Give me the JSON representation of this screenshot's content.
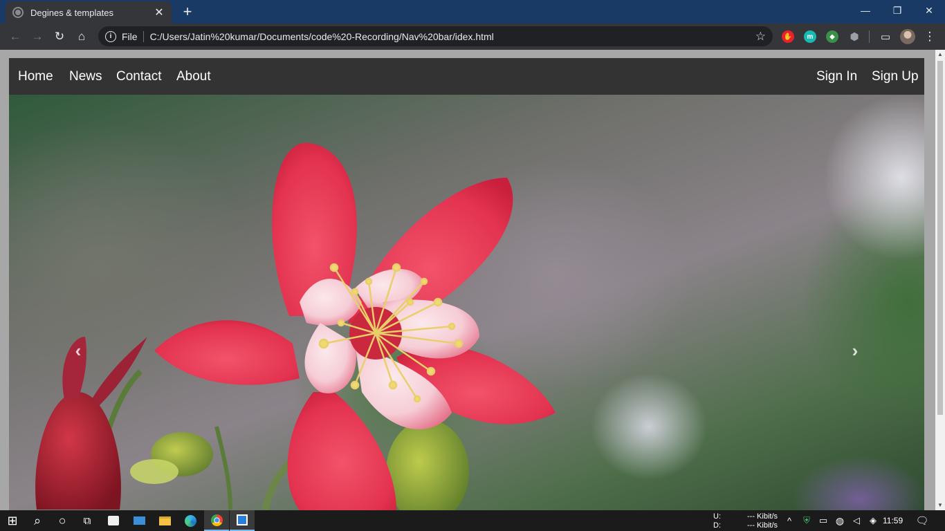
{
  "browser": {
    "tab_title": "Degines & templates",
    "tab_close": "✕",
    "new_tab": "+",
    "window_controls": {
      "minimize": "—",
      "restore": "❐",
      "close": "✕"
    },
    "toolbar": {
      "back": "←",
      "forward": "→",
      "reload": "↻",
      "home": "⌂"
    },
    "address": {
      "info_icon": "i",
      "scheme_label": "File",
      "url": "C:/Users/Jatin%20kumar/Documents/code%20-Recording/Nav%20bar/idex.html",
      "bookmark": "☆"
    },
    "extensions": [
      {
        "name": "adblock-icon",
        "glyph": "✋",
        "color": "#e8212b"
      },
      {
        "name": "m-extension-icon",
        "glyph": "m",
        "color": "#19b8b0"
      },
      {
        "name": "color-extension-icon",
        "glyph": "◆",
        "color": "#3a8f4a"
      },
      {
        "name": "shield-extension-icon",
        "glyph": "⬢",
        "color": "#9aa0a6"
      }
    ],
    "cast": "▭",
    "menu": "⋮"
  },
  "nav": {
    "left": [
      "Home",
      "News",
      "Contact",
      "About"
    ],
    "right": [
      "Sign In",
      "Sign Up"
    ]
  },
  "carousel": {
    "prev": "‹",
    "next": "›"
  },
  "taskbar": {
    "start": "⊞",
    "search": "⌕",
    "cortana": "○",
    "task_view": "⧉",
    "network_up_label": "U:",
    "network_down_label": "D:",
    "network_up": "--- Kibit/s",
    "network_down": "--- Kibit/s",
    "tray_chevron": "^",
    "clock": "11:59",
    "notifications": "🗨"
  }
}
